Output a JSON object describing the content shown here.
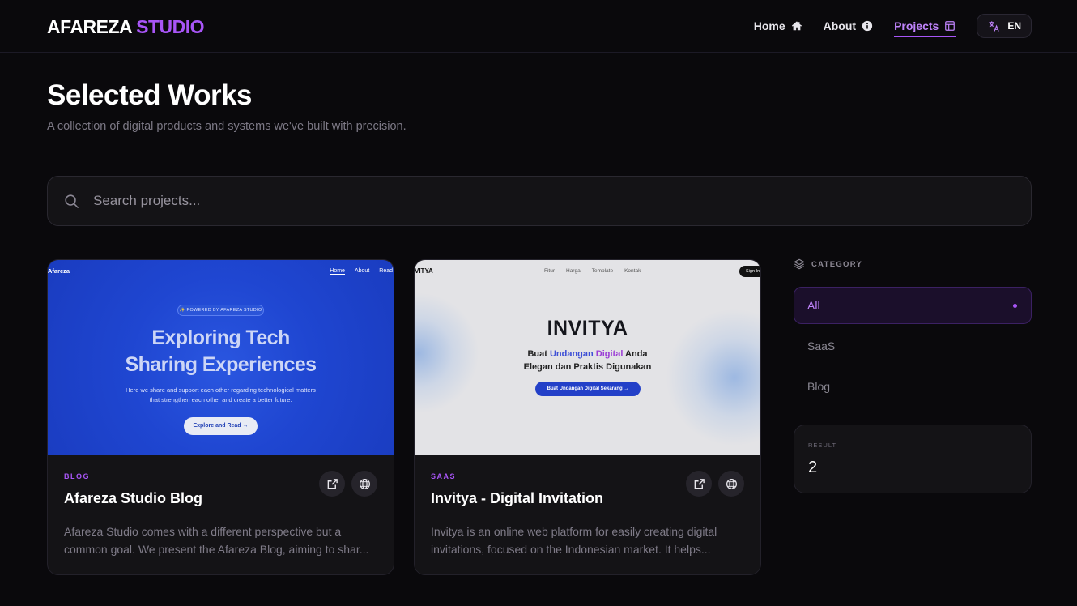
{
  "brand": {
    "name": "AFAREZA",
    "accent": "STUDIO"
  },
  "nav": {
    "home": "Home",
    "about": "About",
    "projects": "Projects",
    "lang": "EN"
  },
  "page": {
    "title": "Selected Works",
    "subtitle": "A collection of digital products and systems we've built with precision."
  },
  "search": {
    "placeholder": "Search projects..."
  },
  "projects": [
    {
      "category": "BLOG",
      "title": "Afareza Studio Blog",
      "description": "Afareza Studio comes with a different perspective but a common goal. We present the Afareza Blog, aiming to shar...",
      "preview": {
        "brand": "Afareza",
        "nav": [
          "Home",
          "About",
          "Read"
        ],
        "pill": "✨ POWERED BY AFAREZA STUDIO",
        "headline_1": "Exploring Tech",
        "headline_2": "Sharing Experiences",
        "text_1": "Here we share and support each other regarding technological matters",
        "text_2": "that strengthen each other and create a better future.",
        "button": "Explore and Read →"
      }
    },
    {
      "category": "SAAS",
      "title": "Invitya - Digital Invitation",
      "description": "Invitya is an online web platform for easily creating digital invitations, focused on the Indonesian market. It helps...",
      "preview": {
        "brand": "VITYA",
        "nav": [
          "Fitur",
          "Harga",
          "Template",
          "Kontak"
        ],
        "signin": "Sign In",
        "headline": "INVITYA",
        "line1_pre": "Buat ",
        "line1_hl1": "Undangan ",
        "line1_hl2": "Digital",
        "line1_post": " Anda",
        "line2": "Elegan dan Praktis Digunakan",
        "button": "Buat Undangan Digital Sekarang →"
      }
    }
  ],
  "sidebar": {
    "category_heading": "CATEGORY",
    "categories": [
      "All",
      "SaaS",
      "Blog"
    ],
    "result_label": "RESULT",
    "result_count": "2"
  },
  "colors": {
    "accent": "#a855f7",
    "background": "#0a090c",
    "card": "#141316"
  },
  "icons": {
    "home": "home-icon",
    "about": "info-icon",
    "projects": "layout-icon",
    "lang": "translate-icon",
    "search": "search-icon",
    "external": "external-link-icon",
    "globe": "globe-icon",
    "category": "layers-icon"
  }
}
